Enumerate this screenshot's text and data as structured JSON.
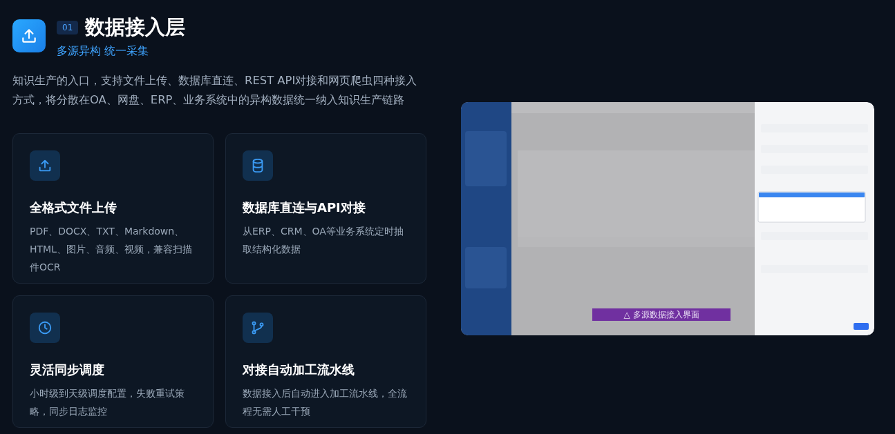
{
  "header": {
    "number": "01",
    "title": "数据接入层",
    "subtitle": "多源异构 统一采集",
    "kind": "upload"
  },
  "description": "知识生产的入口，支持文件上传、数据库直连、REST API对接和网页爬虫四种接入方式，将分散在OA、网盘、ERP、业务系统中的异构数据统一纳入知识生产链路",
  "features": [
    {
      "kind": "upload",
      "title": "全格式文件上传",
      "description": "PDF、DOCX、TXT、Markdown、HTML、图片、音频、视频，兼容扫描件OCR"
    },
    {
      "kind": "database",
      "title": "数据库直连与API对接",
      "description": "从ERP、CRM、OA等业务系统定时抽取结构化数据"
    },
    {
      "kind": "clock",
      "title": "灵活同步调度",
      "description": "小时级到天级调度配置，失败重试策略，同步日志监控"
    },
    {
      "kind": "branch",
      "title": "对接自动加工流水线",
      "description": "数据接入后自动进入加工流水线，全流程无需人工干预"
    }
  ],
  "preview": {
    "kind": "picture",
    "caption": "△ 多源数据接入界面"
  }
}
